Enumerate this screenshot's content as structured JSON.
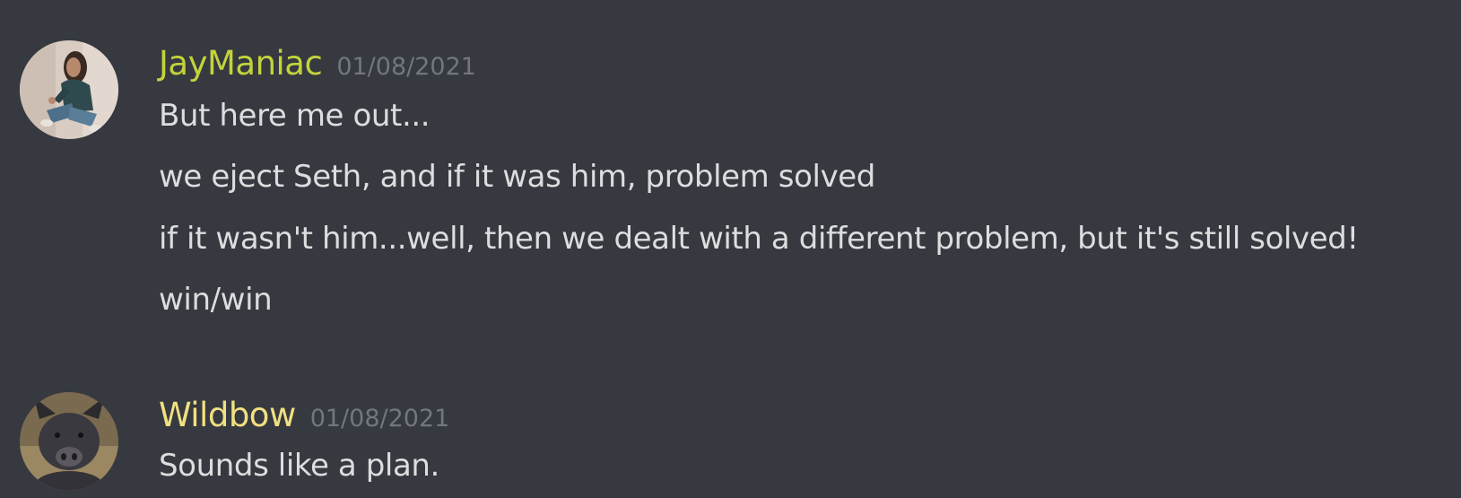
{
  "messages": [
    {
      "username": "JayManiac",
      "timestamp": "01/08/2021",
      "avatar_icon": "user-avatar-woman-sitting",
      "username_color": "#c3d33c",
      "lines": [
        "But here me out...",
        "we eject Seth, and if it was him, problem solved",
        "if it wasn't him...well, then we dealt with a different problem, but it's still solved!",
        "win/win"
      ]
    },
    {
      "username": "Wildbow",
      "timestamp": "01/08/2021",
      "avatar_icon": "user-avatar-pig",
      "username_color": "#f1e081",
      "lines": [
        "Sounds like a plan."
      ]
    }
  ],
  "colors": {
    "background": "#36393f",
    "message_text": "#dcddde",
    "timestamp_text": "#72767d"
  }
}
